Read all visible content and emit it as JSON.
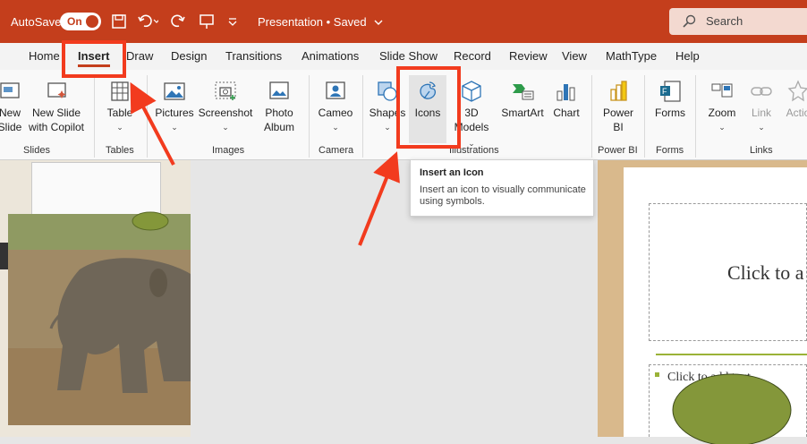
{
  "titlebar": {
    "autosave_label": "AutoSave",
    "toggle_state": "On",
    "doc_title": "Presentation • Saved",
    "search_placeholder": "Search"
  },
  "tabs": [
    "Home",
    "Insert",
    "Draw",
    "Design",
    "Transitions",
    "Animations",
    "Slide Show",
    "Record",
    "Review",
    "View",
    "MathType",
    "Help"
  ],
  "ribbon": {
    "new_slide": {
      "line1": "New",
      "line2": "Slide"
    },
    "new_slide_copilot": {
      "line1": "New Slide",
      "line2": "with Copilot"
    },
    "table": "Table",
    "pictures": "Pictures",
    "screenshot": "Screenshot",
    "photo_album": {
      "line1": "Photo",
      "line2": "Album"
    },
    "cameo": "Cameo",
    "shapes": "Shapes",
    "icons": "Icons",
    "models_3d": {
      "line1": "3D",
      "line2": "Models"
    },
    "smartart": "SmartArt",
    "chart": "Chart",
    "power_bi": {
      "line1": "Power",
      "line2": "BI"
    },
    "forms": "Forms",
    "zoom": "Zoom",
    "link": "Link",
    "action": "Actio",
    "groups": {
      "slides": "Slides",
      "tables": "Tables",
      "images": "Images",
      "camera": "Camera",
      "illustrations": "Illustrations",
      "power_bi": "Power BI",
      "forms": "Forms",
      "links": "Links"
    }
  },
  "tooltip": {
    "title": "Insert an Icon",
    "body": "Insert an icon to visually communicate using symbols."
  },
  "slide": {
    "title_placeholder": "Click to a",
    "body_placeholder": "Click to add text"
  },
  "colors": {
    "titlebar": "#c43e1c",
    "highlight": "#f23b1e",
    "oval": "#84973a"
  }
}
